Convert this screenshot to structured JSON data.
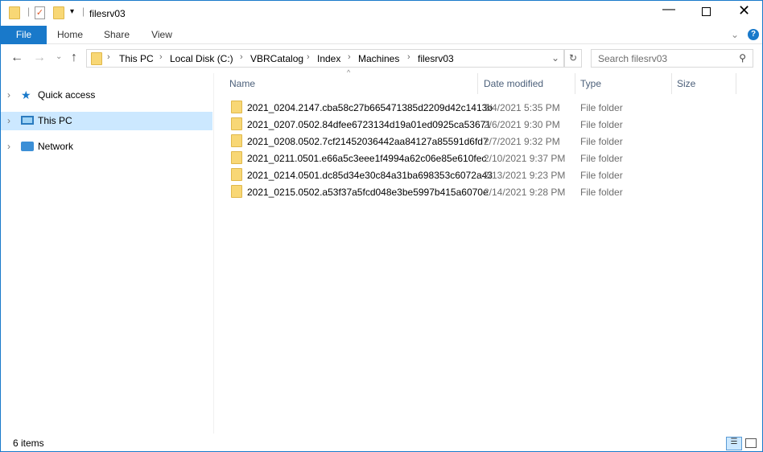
{
  "window": {
    "title": "filesrv03",
    "controls": [
      "minimize",
      "maximize",
      "close"
    ]
  },
  "ribbon": {
    "tabs": [
      "File",
      "Home",
      "Share",
      "View"
    ]
  },
  "address": {
    "crumbs": [
      "This PC",
      "Local Disk (C:)",
      "VBRCatalog",
      "Index",
      "Machines",
      "filesrv03"
    ]
  },
  "search": {
    "placeholder": "Search filesrv03"
  },
  "nav": {
    "items": [
      "Quick access",
      "This PC",
      "Network"
    ]
  },
  "columns": [
    "Name",
    "Date modified",
    "Type",
    "Size"
  ],
  "files": [
    {
      "name": "2021_0204.2147.cba58c27b665471385d2209d42c1413b",
      "date": "2/4/2021 5:35 PM",
      "type": "File folder"
    },
    {
      "name": "2021_0207.0502.84dfee6723134d19a01ed0925ca53671",
      "date": "2/6/2021 9:30 PM",
      "type": "File folder"
    },
    {
      "name": "2021_0208.0502.7cf21452036442aa84127a85591d6fd7",
      "date": "2/7/2021 9:32 PM",
      "type": "File folder"
    },
    {
      "name": "2021_0211.0501.e66a5c3eee1f4994a62c06e85e610fec",
      "date": "2/10/2021 9:37 PM",
      "type": "File folder"
    },
    {
      "name": "2021_0214.0501.dc85d34e30c84a31ba698353c6072a43",
      "date": "2/13/2021 9:23 PM",
      "type": "File folder"
    },
    {
      "name": "2021_0215.0502.a53f37a5fcd048e3be5997b415a6070e",
      "date": "2/14/2021 9:28 PM",
      "type": "File folder"
    }
  ],
  "status": {
    "count": "6 items"
  },
  "colors": {
    "accent": "#1979ca",
    "selected": "#cce8ff"
  }
}
